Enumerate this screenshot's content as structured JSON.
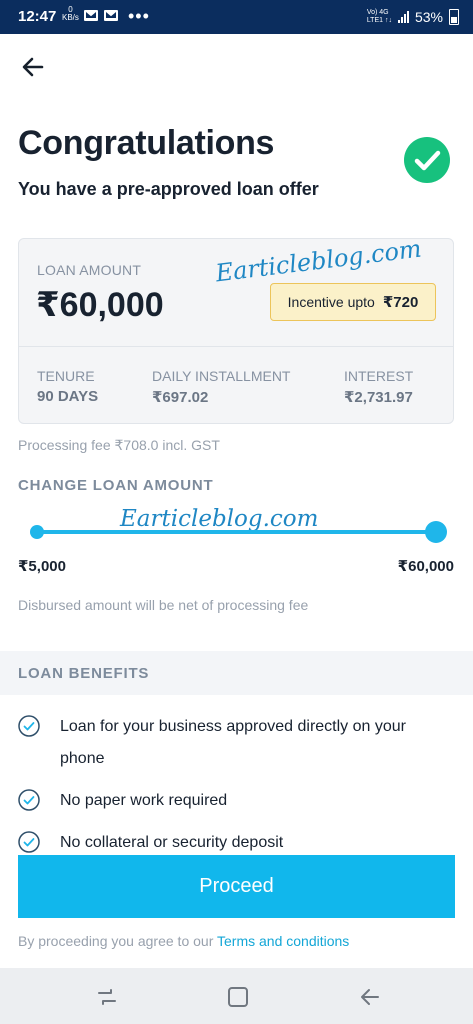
{
  "status_bar": {
    "time": "12:47",
    "net_speed_value": "0",
    "net_speed_unit": "KB/s",
    "overflow": "•••",
    "network_line1": "Vo) 4G",
    "network_line2": "LTE1 ↑↓",
    "battery": "53%"
  },
  "header": {
    "back_icon": "arrow-left-icon",
    "title": "Congratulations",
    "subtitle": "You have a pre-approved loan offer",
    "success_icon": "check-circle-icon",
    "success_color": "#17c17e"
  },
  "loan_card": {
    "amount_label": "LOAN AMOUNT",
    "amount": "₹60,000",
    "watermark": "Earticleblog.com",
    "incentive_label": "Incentive upto",
    "incentive_value": "₹720",
    "stats": [
      {
        "label": "TENURE",
        "value": "90 DAYS"
      },
      {
        "label": "DAILY INSTALLMENT",
        "value": "₹697.02"
      },
      {
        "label": "INTEREST",
        "value": "₹2,731.97"
      }
    ]
  },
  "processing_fee": "Processing fee ₹708.0 incl. GST",
  "change_amount": {
    "heading": "CHANGE LOAN AMOUNT",
    "watermark": "Earticleblog.com",
    "min_label": "₹5,000",
    "max_label": "₹60,000",
    "selected_fraction": 1.0,
    "note": "Disbursed amount will be net of processing fee"
  },
  "benefits": {
    "heading": "LOAN BENEFITS",
    "items": [
      "Loan for your business approved directly on your phone",
      "No paper work required",
      "No collateral or security deposit"
    ]
  },
  "footer": {
    "proceed_label": "Proceed",
    "terms_prefix": "By proceeding you agree to our",
    "terms_link": "Terms and conditions"
  },
  "colors": {
    "accent": "#11b7ec",
    "status_bar": "#0b2d5e",
    "incentive_bg": "#fbf1c9"
  },
  "nav_bar": {
    "icons": [
      "recent-apps-icon",
      "home-icon",
      "back-icon"
    ]
  }
}
